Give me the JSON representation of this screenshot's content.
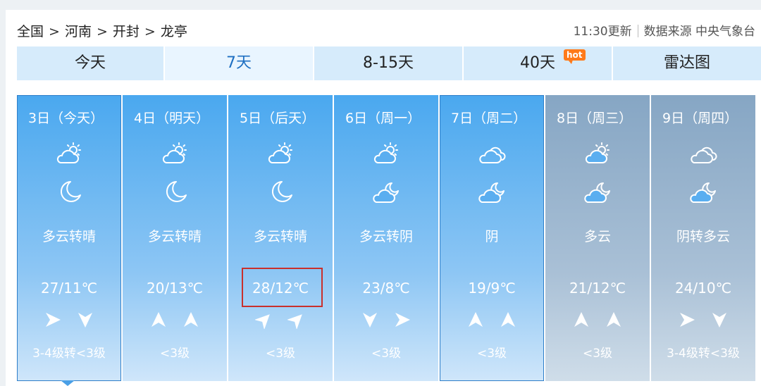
{
  "breadcrumb": [
    "全国",
    "河南",
    "开封",
    "龙亭"
  ],
  "breadcrumb_sep": ">",
  "meta": {
    "updated": "11:30更新",
    "source": "数据来源 中央气象台"
  },
  "tabs": [
    {
      "label": "今天"
    },
    {
      "label": "7天"
    },
    {
      "label": "8-15天"
    },
    {
      "label": "40天",
      "badge": "hot"
    },
    {
      "label": "雷达图"
    }
  ],
  "days": [
    {
      "date": "3日（今天）",
      "day_icon": "partly-cloudy-day",
      "night_icon": "moon",
      "desc": "多云转晴",
      "temp": "27/11℃",
      "wind1": "east-arrow",
      "wind2": "south-arrow",
      "wind_level": "3-4级转<3级"
    },
    {
      "date": "4日（明天）",
      "day_icon": "partly-cloudy-day",
      "night_icon": "moon",
      "desc": "多云转晴",
      "temp": "20/13℃",
      "wind1": "north-arrow",
      "wind2": "north-arrow",
      "wind_level": "<3级"
    },
    {
      "date": "5日（后天）",
      "day_icon": "partly-cloudy-day",
      "night_icon": "moon",
      "desc": "多云转晴",
      "temp": "28/12℃",
      "wind1": "northeast-arrow",
      "wind2": "northeast-arrow",
      "wind_level": "<3级"
    },
    {
      "date": "6日（周一）",
      "day_icon": "partly-cloudy-day",
      "night_icon": "partly-cloudy-night",
      "desc": "多云转阴",
      "temp": "23/8℃",
      "wind1": "south-arrow",
      "wind2": "east-arrow",
      "wind_level": "<3级"
    },
    {
      "date": "7日（周二）",
      "day_icon": "overcast",
      "night_icon": "partly-cloudy-night",
      "desc": "阴",
      "temp": "19/9℃",
      "wind1": "north-arrow",
      "wind2": "north-arrow",
      "wind_level": "<3级"
    },
    {
      "date": "8日（周三）",
      "day_icon": "partly-cloudy-day",
      "night_icon": "partly-cloudy-night",
      "desc": "多云",
      "temp": "21/12℃",
      "wind1": "north-arrow",
      "wind2": "north-arrow",
      "wind_level": "<3级"
    },
    {
      "date": "9日（周四）",
      "day_icon": "overcast",
      "night_icon": "partly-cloudy-night",
      "desc": "阴转多云",
      "temp": "24/10℃",
      "wind1": "east-arrow",
      "wind2": "south-arrow",
      "wind_level": "3-4级转<3级"
    }
  ],
  "colors": {
    "active_tab_text": "#1e6fc2",
    "highlight_border": "#c9302c",
    "hot_badge": "#ff7a1a"
  }
}
